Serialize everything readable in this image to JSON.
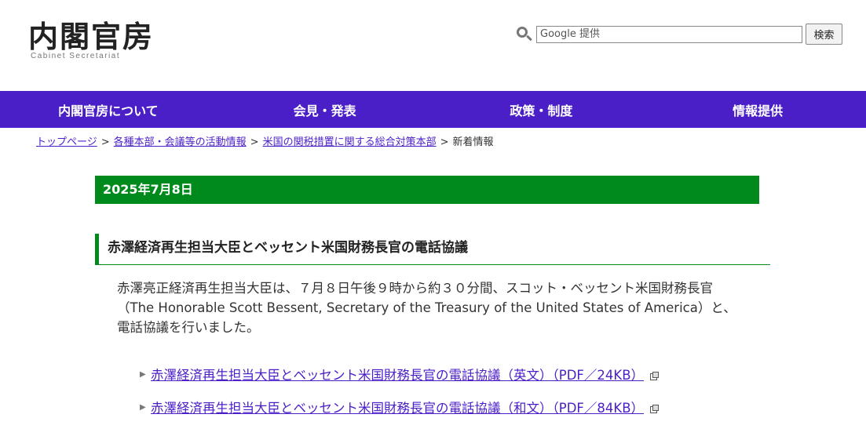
{
  "header": {
    "logo_title": "内閣官房",
    "logo_subtitle": "Cabinet Secretariat",
    "search": {
      "placeholder": "Google 提供",
      "button_label": "検索"
    }
  },
  "nav": {
    "items": [
      {
        "label": "内閣官房について"
      },
      {
        "label": "会見・発表"
      },
      {
        "label": "政策・制度"
      },
      {
        "label": "情報提供"
      }
    ]
  },
  "breadcrumb": {
    "items": [
      {
        "label": "トップページ"
      },
      {
        "label": "各種本部・会議等の活動情報"
      },
      {
        "label": "米国の関税措置に関する総合対策本部"
      }
    ],
    "current": "新着情報",
    "separator": ">"
  },
  "content": {
    "date": "2025年7月8日",
    "heading": "赤澤経済再生担当大臣とベッセント米国財務長官の電話協議",
    "body": "赤澤亮正経済再生担当大臣は、７月８日午後９時から約３０分間、スコット・ベッセント米国財務長官（The Honorable Scott Bessent, Secretary of the Treasury of the United States of America）と、電話協議を行いました。",
    "links": [
      {
        "label": "赤澤経済再生担当大臣とベッセント米国財務長官の電話協議（英文）（PDF／24KB）"
      },
      {
        "label": "赤澤経済再生担当大臣とベッセント米国財務長官の電話協議（和文）（PDF／84KB）"
      }
    ]
  },
  "colors": {
    "nav_background": "#4b1fc7",
    "accent_green": "#008a1c",
    "link": "#4b1fc7"
  }
}
